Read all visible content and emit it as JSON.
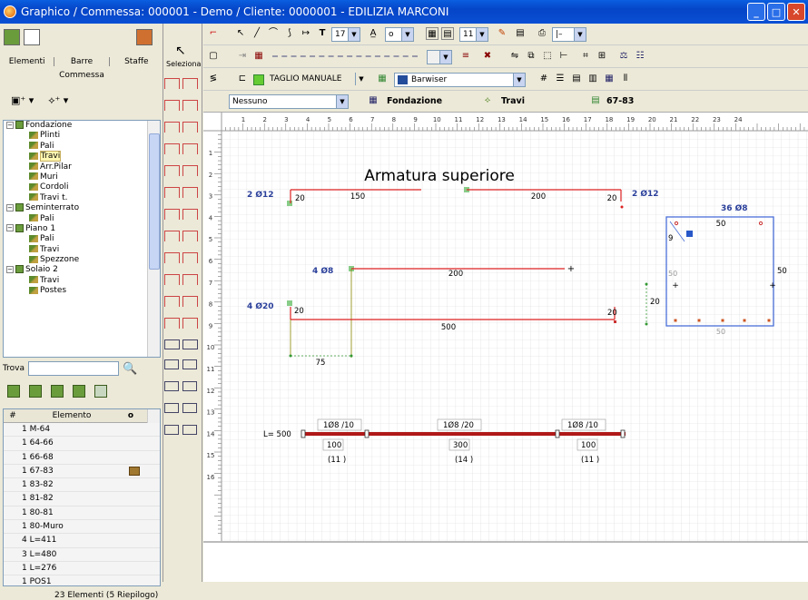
{
  "window": {
    "title": "Graphico / Commessa: 000001 - Demo / Cliente: 0000001 - EDILIZIA MARCONI"
  },
  "left": {
    "tabs": [
      "Elementi",
      "Barre",
      "Staffe"
    ],
    "commessa": "Commessa",
    "tree": [
      {
        "label": "Fondazione",
        "level": 0,
        "type": "group",
        "expanded": true
      },
      {
        "label": "Plinti",
        "level": 1
      },
      {
        "label": "Pali",
        "level": 1
      },
      {
        "label": "Travi",
        "level": 1,
        "selected": true
      },
      {
        "label": "Arr.Pilar",
        "level": 1
      },
      {
        "label": "Muri",
        "level": 1
      },
      {
        "label": "Cordoli",
        "level": 1
      },
      {
        "label": "Travi t.",
        "level": 1
      },
      {
        "label": "Seminterrato",
        "level": 0,
        "type": "group",
        "expanded": true
      },
      {
        "label": "Pali",
        "level": 1
      },
      {
        "label": "Piano 1",
        "level": 0,
        "type": "group",
        "expanded": true
      },
      {
        "label": "Pali",
        "level": 1
      },
      {
        "label": "Travi",
        "level": 1
      },
      {
        "label": "Spezzone",
        "level": 1
      },
      {
        "label": "Solaio 2",
        "level": 0,
        "type": "group",
        "expanded": true
      },
      {
        "label": "Travi",
        "level": 1
      },
      {
        "label": "Postes",
        "level": 1
      }
    ],
    "trova_label": "Trova",
    "table_headers": {
      "num": "#",
      "elem": "Elemento",
      "o": "o"
    },
    "table_rows": [
      {
        "num": "1",
        "elem": "M-64"
      },
      {
        "num": "1",
        "elem": "64-66"
      },
      {
        "num": "1",
        "elem": "66-68"
      },
      {
        "num": "1",
        "elem": "67-83"
      },
      {
        "num": "1",
        "elem": "83-82"
      },
      {
        "num": "1",
        "elem": "81-82"
      },
      {
        "num": "1",
        "elem": "80-81"
      },
      {
        "num": "1",
        "elem": "80-Muro"
      },
      {
        "num": "4",
        "elem": "L=411"
      },
      {
        "num": "3",
        "elem": "L=480"
      },
      {
        "num": "1",
        "elem": "L=276"
      },
      {
        "num": "1",
        "elem": "POS1"
      }
    ],
    "status": "23 Elementi (5 Riepilogo)"
  },
  "toolcol": {
    "seleziona": "Seleziona"
  },
  "toolbar": {
    "font_size": "17",
    "small_size": "11",
    "taglio": "TAGLIO MANUALE",
    "barwiser": "Barwiser",
    "nessuno": "Nessuno",
    "fondazione": "Fondazione",
    "travi": "Travi",
    "elem_code": "67-83"
  },
  "drawing": {
    "title": "Armatura superiore",
    "ruler_numbers": [
      "1",
      "2",
      "3",
      "4",
      "5",
      "6",
      "7",
      "8",
      "9",
      "10",
      "11",
      "12",
      "13",
      "14",
      "15",
      "16",
      "17",
      "18",
      "19",
      "20",
      "21",
      "22",
      "23",
      "24"
    ],
    "vruler_numbers": [
      "1",
      "2",
      "3",
      "4",
      "5",
      "6",
      "7",
      "8",
      "9",
      "10",
      "11",
      "12",
      "13",
      "14",
      "15",
      "16"
    ],
    "bar1": {
      "label": "2 Ø12",
      "left": "20",
      "mid1": "150",
      "mid2": "200",
      "right": "20",
      "label_right": "2 Ø12"
    },
    "bar2": {
      "label": "4 Ø8",
      "mid": "200"
    },
    "bar3": {
      "label": "4 Ø20",
      "left": "20",
      "mid": "500",
      "right": "20",
      "bottom": "75"
    },
    "section": {
      "label": "36 Ø8",
      "top": "50",
      "left": "50",
      "right": "50",
      "bottom": "50",
      "side": "9",
      "h": "20"
    },
    "stirrups": {
      "L": "L= 500",
      "s1": "1Ø8 /10",
      "s2": "1Ø8 /20",
      "s3": "1Ø8 /10",
      "d1": "100",
      "d2": "300",
      "d3": "100",
      "n1": "(11 )",
      "n2": "(14 )",
      "n3": "(11 )"
    }
  }
}
